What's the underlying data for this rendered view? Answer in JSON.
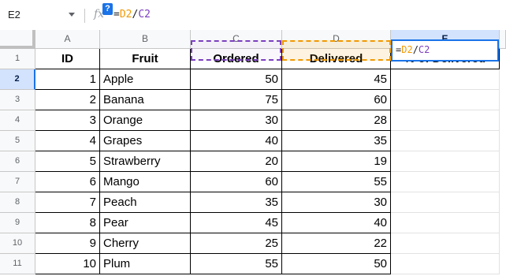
{
  "formula_bar": {
    "name_box": "E2",
    "help_badge": "?",
    "fx_label": "fx",
    "formula_eq": "=",
    "formula_d2": "D2",
    "formula_div": "/",
    "formula_c2": "C2"
  },
  "columns": [
    "A",
    "B",
    "C",
    "D",
    "E"
  ],
  "selected_column": "E",
  "rows": [
    "1",
    "2",
    "3",
    "4",
    "5",
    "6",
    "7",
    "8",
    "9",
    "10",
    "11"
  ],
  "selected_row": "2",
  "header": [
    "ID",
    "Fruit",
    "Ordered",
    "Delivered",
    "% of Delivered"
  ],
  "data": [
    {
      "id": "1",
      "fruit": "Apple",
      "ordered": "50",
      "delivered": "45"
    },
    {
      "id": "2",
      "fruit": "Banana",
      "ordered": "75",
      "delivered": "60"
    },
    {
      "id": "3",
      "fruit": "Orange",
      "ordered": "30",
      "delivered": "28"
    },
    {
      "id": "4",
      "fruit": "Grapes",
      "ordered": "40",
      "delivered": "35"
    },
    {
      "id": "5",
      "fruit": "Strawberry",
      "ordered": "20",
      "delivered": "19"
    },
    {
      "id": "6",
      "fruit": "Mango",
      "ordered": "60",
      "delivered": "55"
    },
    {
      "id": "7",
      "fruit": "Peach",
      "ordered": "35",
      "delivered": "30"
    },
    {
      "id": "8",
      "fruit": "Pear",
      "ordered": "45",
      "delivered": "40"
    },
    {
      "id": "9",
      "fruit": "Cherry",
      "ordered": "25",
      "delivered": "22"
    },
    {
      "id": "10",
      "fruit": "Plum",
      "ordered": "55",
      "delivered": "50"
    }
  ],
  "active_cell": {
    "ref": "E2",
    "eq": "=",
    "d2": "D2",
    "div": "/",
    "c2": "C2"
  },
  "colors": {
    "ref_c2": "#7b3fbf",
    "ref_d2": "#f29900",
    "selection": "#1a73e8",
    "header_selected_bg": "#d3e3fd"
  }
}
